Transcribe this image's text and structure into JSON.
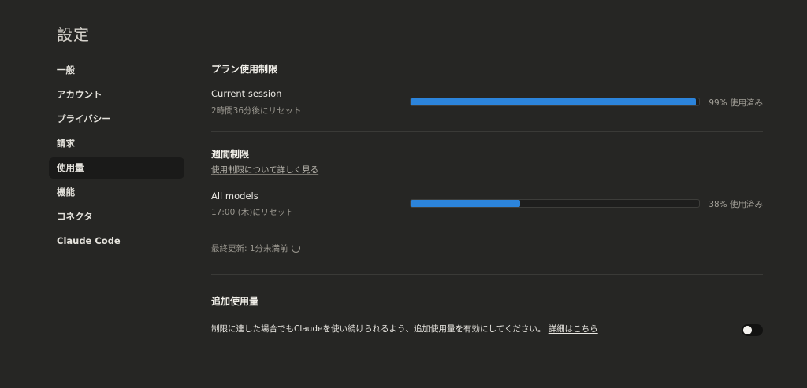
{
  "page": {
    "title": "設定"
  },
  "sidebar": {
    "items": [
      {
        "label": "一般",
        "active": false
      },
      {
        "label": "アカウント",
        "active": false
      },
      {
        "label": "プライバシー",
        "active": false
      },
      {
        "label": "請求",
        "active": false
      },
      {
        "label": "使用量",
        "active": true
      },
      {
        "label": "機能",
        "active": false
      },
      {
        "label": "コネクタ",
        "active": false
      },
      {
        "label": "Claude Code",
        "active": false
      }
    ]
  },
  "plan_limits": {
    "title": "プラン使用制限",
    "current_session": {
      "label": "Current session",
      "reset_text": "2時間36分後にリセット",
      "percent": 99,
      "percent_text": "99% 使用済み"
    }
  },
  "weekly_limits": {
    "title": "週間制限",
    "learn_more_link": "使用制限について詳しく見る",
    "all_models": {
      "label": "All models",
      "reset_text": "17:00 (木)にリセット",
      "percent": 38,
      "percent_text": "38% 使用済み"
    },
    "last_updated": "最終更新: 1分未満前"
  },
  "extra_usage": {
    "title": "追加使用量",
    "description": "制限に達した場合でもClaudeを使い続けられるよう、追加使用量を有効にしてください。",
    "details_link": "詳細はこちら",
    "enabled": false
  },
  "colors": {
    "background": "#262624",
    "progress_fill": "#2c84db",
    "active_nav": "#1a1a19"
  }
}
